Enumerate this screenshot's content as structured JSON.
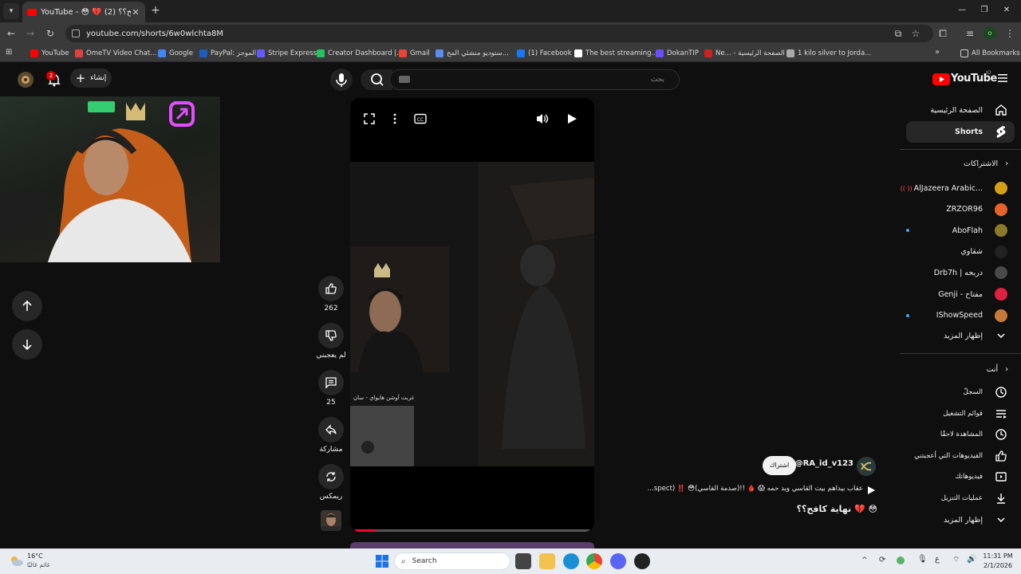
{
  "browser": {
    "active_tab_title": "YouTube - 😳 💔 (2) نهاية كافح؟؟",
    "url": "youtube.com/shorts/6w0wlchta8M",
    "bookmarks": [
      {
        "label": "YouTube",
        "color": "#ff0000"
      },
      {
        "label": "OmeTV Video Chat...",
        "color": "#e04040"
      },
      {
        "label": "Google",
        "color": "#4285f4"
      },
      {
        "label": "PayPal: الموجز",
        "color": "#1d5cbf"
      },
      {
        "label": "Stripe Express",
        "color": "#635bff"
      },
      {
        "label": "Creator Dashboard |...",
        "color": "#22c55e"
      },
      {
        "label": "Gmail",
        "color": "#ea4335"
      },
      {
        "label": "ستوديو منشئي المح...",
        "color": "#5b8def"
      },
      {
        "label": "(1) Facebook",
        "color": "#1877f2"
      },
      {
        "label": "The best streaming...",
        "color": "#ffffff"
      },
      {
        "label": "DokanTIP",
        "color": "#6b4eff"
      },
      {
        "label": "Ne... - الصفحة الرئيسية",
        "color": "#cc2222"
      },
      {
        "label": "1 kilo silver to Jorda...",
        "color": "#aaaaaa"
      }
    ],
    "all_bookmarks_label": "All Bookmarks",
    "profile_initial": "o"
  },
  "youtube": {
    "logo_text": "YouTube",
    "logo_sup": "JO",
    "search_placeholder": "بحث",
    "create_label": "إنشاء",
    "notification_count": "2"
  },
  "sidebar": {
    "home": "الصفحة الرئيسية",
    "shorts": "Shorts",
    "subscriptions_header": "الاشتراكات",
    "channels": [
      {
        "name": "AlJazeera Arabic...",
        "color": "#d4a017",
        "live": true
      },
      {
        "name": "ZRZOR96",
        "color": "#e8632b",
        "live": false
      },
      {
        "name": "AboFlah",
        "color": "#8a7a2a",
        "live": false,
        "dot": true
      },
      {
        "name": "شقاوي",
        "color": "#222222",
        "live": false
      },
      {
        "name": "Drb7h | دربحه",
        "color": "#4a4a4a",
        "live": false
      },
      {
        "name": "Genji - مفتاح",
        "color": "#e02040",
        "live": false
      },
      {
        "name": "IShowSpeed",
        "color": "#c87a3a",
        "live": false,
        "dot": true
      }
    ],
    "show_more_1": "إظهار المزيد",
    "you_header": "أنت",
    "you_items": [
      {
        "label": "السجلّ",
        "icon": "history-icon"
      },
      {
        "label": "قوائم التشغيل",
        "icon": "playlists-icon"
      },
      {
        "label": "المشاهدة لاحقًا",
        "icon": "watch-later-icon"
      },
      {
        "label": "الفيديوهات التي أعجبتني",
        "icon": "liked-videos-icon"
      },
      {
        "label": "فيديوهاتك",
        "icon": "your-videos-icon"
      },
      {
        "label": "عمليات التنزيل",
        "icon": "downloads-icon"
      }
    ],
    "show_more_2": "إظهار المزيد"
  },
  "short": {
    "likes": "262",
    "dislike_label": "لم يعجبني",
    "comments": "25",
    "share_label": "مشاركة",
    "remix_label": "ريمكس",
    "overlay_caption": "غربت أوشن هايواي - سان",
    "channel_handle": "@RA_id_v123",
    "subscribe_label": "اشتراك",
    "description": "...spect) ‼️ 😳(صدمة القاسي)!! 🩸 😱 عقاب بيداهم بيت القاسي ويد حمه",
    "title": "نهاية كافح؟؟ 💔 😳",
    "progress": 0.09
  },
  "taskbar": {
    "weather_temp": "16°C",
    "weather_desc": "غائم غالبًا",
    "search_placeholder": "Search",
    "time": "11:31 PM",
    "date": "2/1/2026",
    "lang": "ع"
  }
}
